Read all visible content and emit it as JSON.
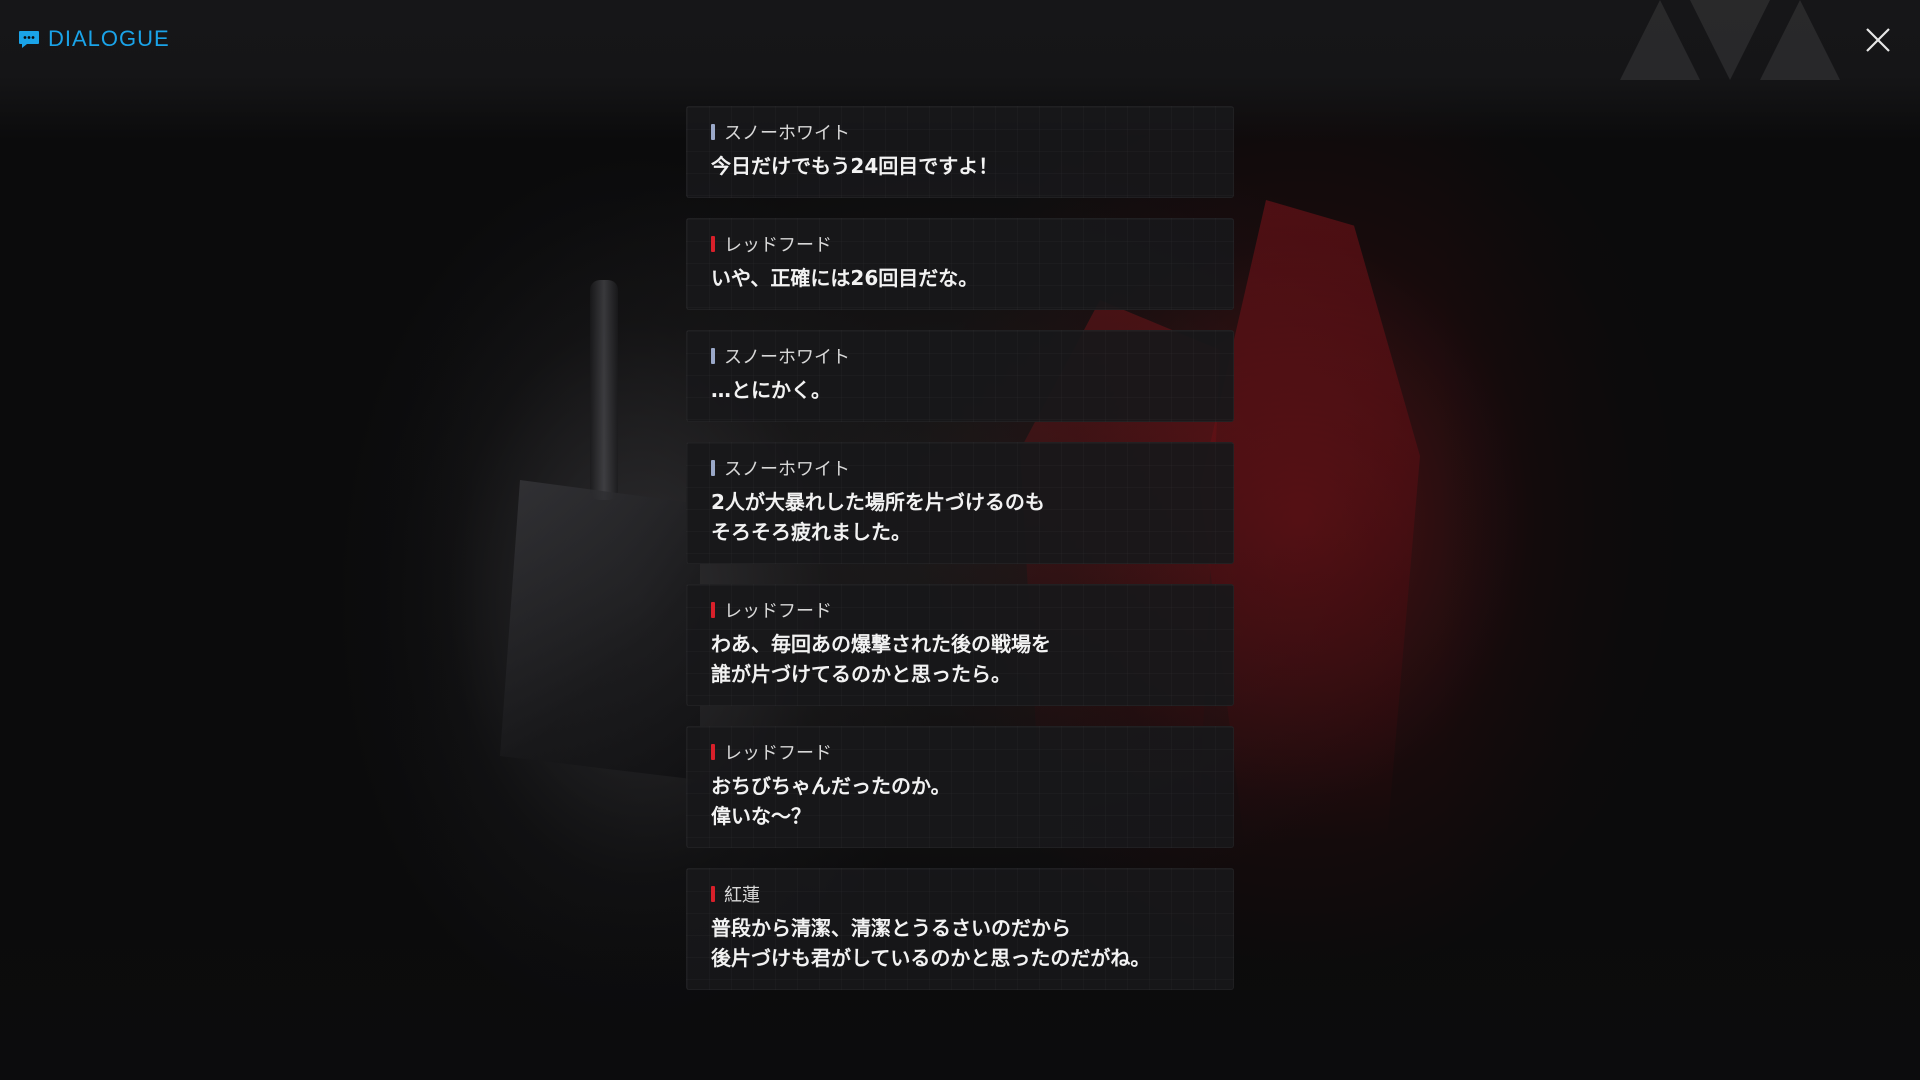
{
  "header": {
    "title": "DIALOGUE",
    "icon": "chat-bubble-icon",
    "accent_color": "#1aa3e8"
  },
  "close_button": {
    "icon": "close-icon"
  },
  "colors": {
    "snow_white_mark": "#9aa8c8",
    "red_hood_mark": "#d8202a",
    "kouren_mark": "#d8202a"
  },
  "dialogue": [
    {
      "speaker": "スノーホワイト",
      "text": "今日だけでもう24回目ですよ！",
      "mark_color": "#9aa8c8"
    },
    {
      "speaker": "レッドフード",
      "text": "いや、正確には26回目だな。",
      "mark_color": "#d8202a"
    },
    {
      "speaker": "スノーホワイト",
      "text": "…とにかく。",
      "mark_color": "#9aa8c8"
    },
    {
      "speaker": "スノーホワイト",
      "text": "2人が大暴れした場所を片づけるのも\nそろそろ疲れました。",
      "mark_color": "#9aa8c8"
    },
    {
      "speaker": "レッドフード",
      "text": "わあ、毎回あの爆撃された後の戦場を\n誰が片づけてるのかと思ったら。",
      "mark_color": "#d8202a"
    },
    {
      "speaker": "レッドフード",
      "text": "おちびちゃんだったのか。\n偉いな～？",
      "mark_color": "#d8202a"
    },
    {
      "speaker": "紅蓮",
      "text": "普段から清潔、清潔とうるさいのだから\n後片づけも君がしているのかと思ったのだがね。",
      "mark_color": "#d8202a"
    }
  ]
}
